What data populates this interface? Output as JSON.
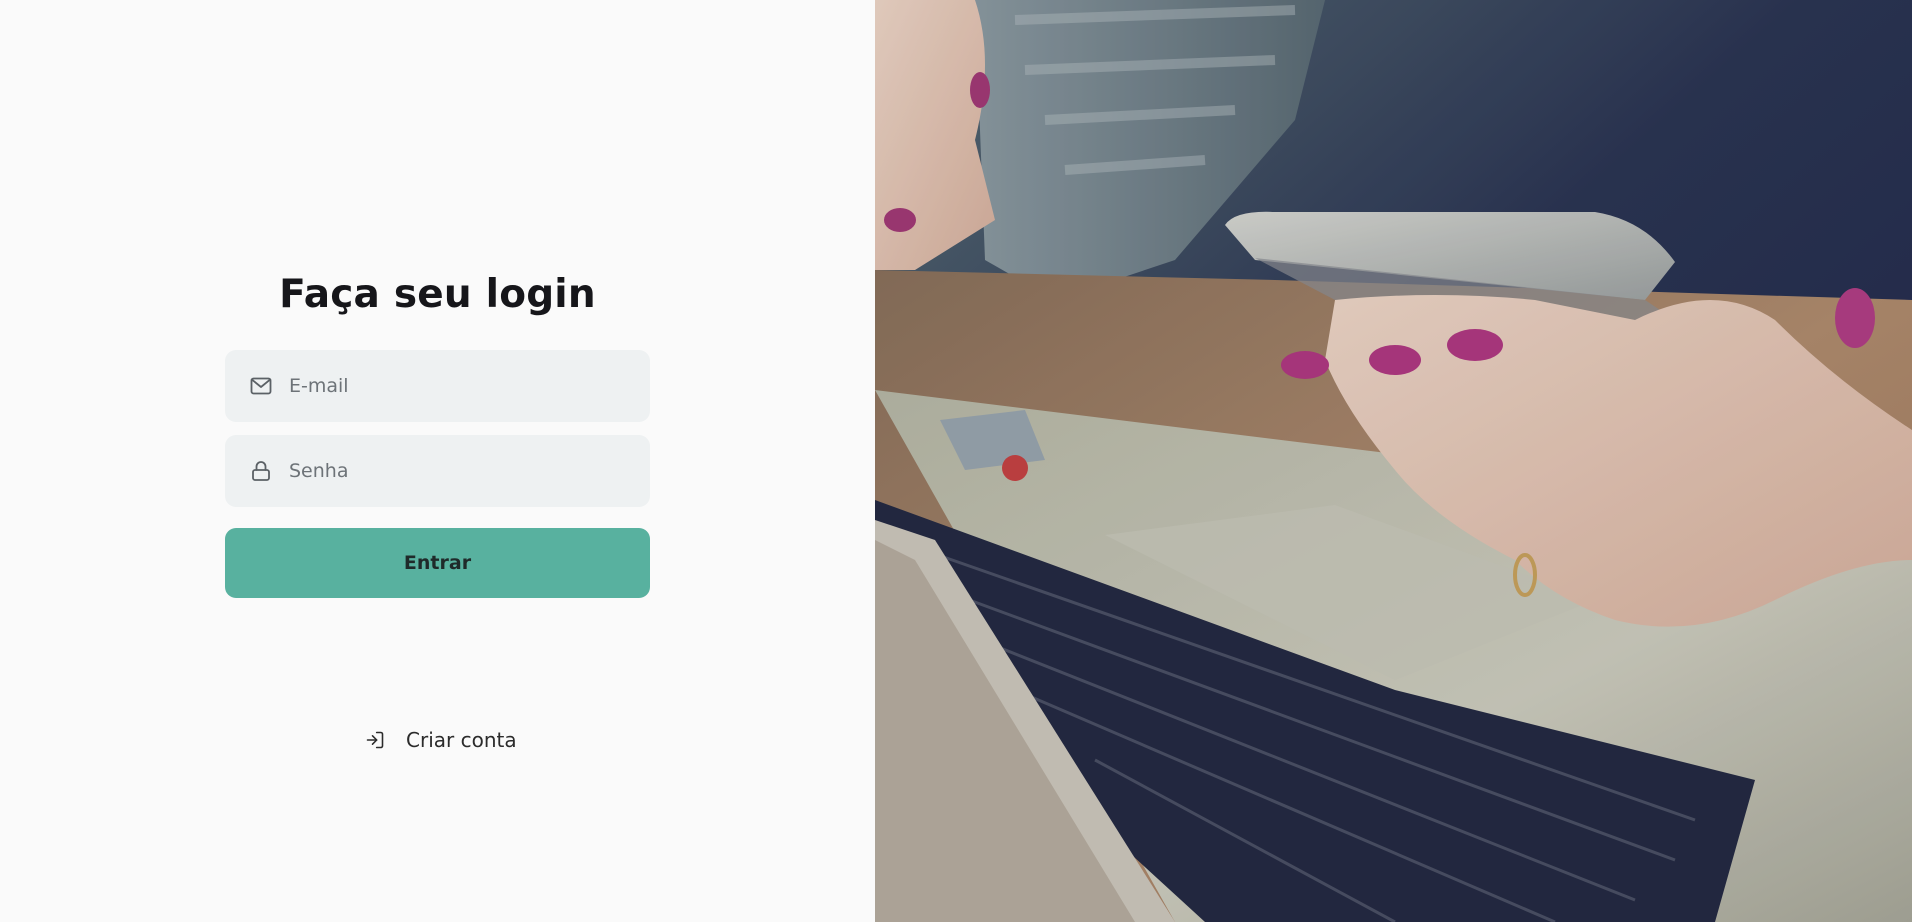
{
  "login": {
    "title": "Faça seu login",
    "email_placeholder": "E-mail",
    "password_placeholder": "Senha",
    "submit_label": "Entrar",
    "create_account_label": "Criar conta"
  },
  "icons": {
    "email": "mail-icon",
    "password": "lock-icon",
    "create_account": "log-in-icon"
  },
  "colors": {
    "accent": "#58b19f",
    "input_bg": "#eef1f2",
    "page_bg": "#fafafa"
  }
}
